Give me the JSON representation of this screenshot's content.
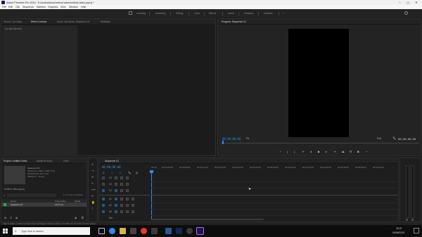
{
  "titlebar": {
    "title": "Adobe Premiere Pro 2019 - E:\\work\\videos\\vertical video\\vertical video.prproj *"
  },
  "menubar": [
    "File",
    "Edit",
    "Clip",
    "Sequence",
    "Markers",
    "Graphics",
    "View",
    "Window",
    "Help"
  ],
  "workspaces": [
    "Learning",
    "Assembly",
    "Editing",
    "Color",
    "Effects",
    "Audio",
    "Graphics",
    "Libraries"
  ],
  "source_panel": {
    "tabs": [
      "Source: (no clips)",
      "Effect Controls",
      "Audio Clip Mixer: Sequence 01",
      "Metadata"
    ],
    "label": "(no clip selected)"
  },
  "program_panel": {
    "tab": "Program: Sequence 01",
    "timecode": "00;00;00;00",
    "zoom": "Fit",
    "quality": "Full",
    "duration": "00;00;00;00"
  },
  "project_panel": {
    "tabs": [
      "Project: Untitled Video",
      "Media Browser",
      "Libra"
    ],
    "item_name": "Sequence 01",
    "item_info": [
      "Sequence, 1080 x 1920 (1.0)",
      "00;00;00;00, 29.97 fps",
      "48000 Hz - Stereo"
    ],
    "project_file": "Untitled Video.prproj",
    "count": "1 of 1 items selected",
    "columns": [
      "Name",
      "Frame Rate",
      "Media"
    ],
    "row_name": "Sequence 01",
    "row_fps": "29.97 fps"
  },
  "sequence_panel": {
    "tab": "Sequence 01",
    "timecode": "00;00;00;00",
    "ruler": [
      "00;00",
      "00;00;04;00",
      "00;00;08;00",
      "00;00;12;00",
      "00;00;16;00",
      "00;00;20;00",
      "00;00;24;00",
      "00;00;28;00",
      "00;00;32;00",
      "00;00;36;00",
      "00;00;40;00",
      "00;00;44;00",
      "00;00;48;00",
      "00;00;52;00",
      "00;00;56;00",
      "00;01;00;02",
      "00;01;04;02"
    ],
    "video_tracks": [
      "V3",
      "V2",
      "V1"
    ],
    "audio_tracks": [
      "A1",
      "A2",
      "A3"
    ],
    "mix_label": "Mix"
  },
  "status_bar": "Click to select, or click in empty space and drag to marquee select. Use Shift, Alt, and Ctrl for other options.",
  "taskbar": {
    "search_placeholder": "Type here to search",
    "time": "18:37",
    "date": "04/06/2019"
  },
  "colors": {
    "accent_blue": "#2d8ceb",
    "premiere_purple": "#2a0e54"
  }
}
